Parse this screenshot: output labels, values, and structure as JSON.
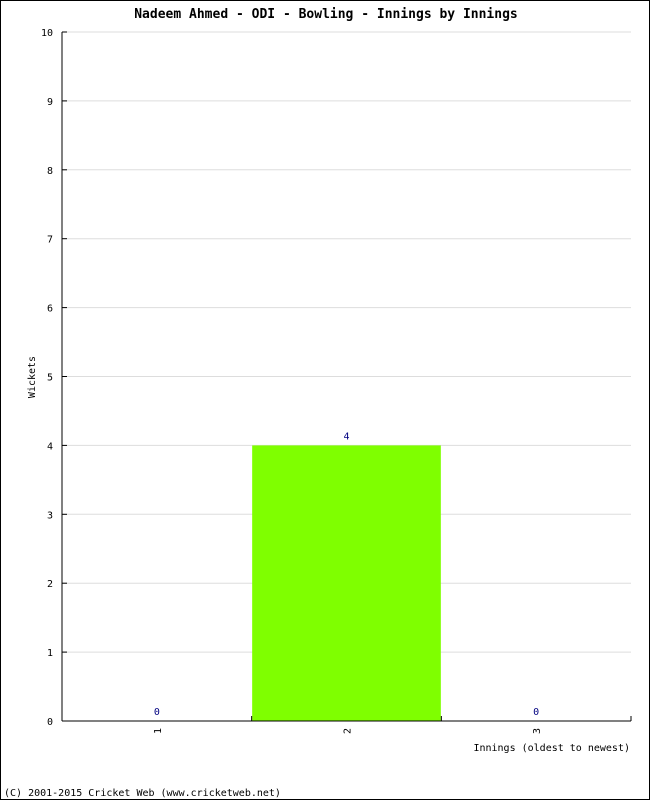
{
  "chart_data": {
    "type": "bar",
    "title": "Nadeem Ahmed - ODI - Bowling - Innings by Innings",
    "xlabel": "Innings (oldest to newest)",
    "ylabel": "Wickets",
    "categories": [
      "1",
      "2",
      "3"
    ],
    "values": [
      0,
      4,
      0
    ],
    "data_labels": [
      "0",
      "4",
      "0"
    ],
    "ylim": [
      0,
      10
    ],
    "yticks": [
      "0",
      "1",
      "2",
      "3",
      "4",
      "5",
      "6",
      "7",
      "8",
      "9",
      "10"
    ],
    "grid": true,
    "bar_color": "#7fff00",
    "label_color": "#000080",
    "grid_color": "#dddddd"
  },
  "footer": "(C) 2001-2015 Cricket Web (www.cricketweb.net)"
}
